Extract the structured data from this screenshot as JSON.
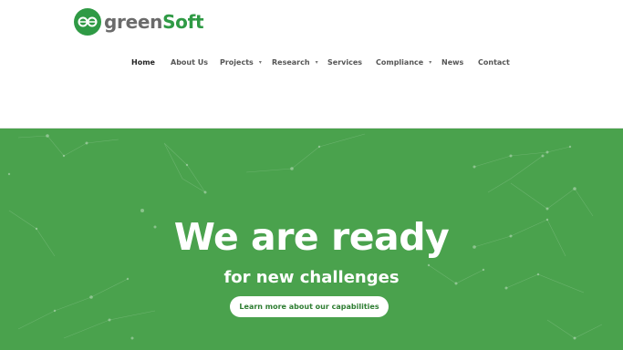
{
  "brand": {
    "name_part1": "green",
    "name_part2": "Soft",
    "mark_icon": "infinity-loops-icon"
  },
  "nav": {
    "items": [
      {
        "label": "Home",
        "active": true,
        "dropdown": false
      },
      {
        "label": "About Us",
        "active": false,
        "dropdown": false
      },
      {
        "label": "Projects",
        "active": false,
        "dropdown": true
      },
      {
        "label": "Research",
        "active": false,
        "dropdown": true
      },
      {
        "label": "Services",
        "active": false,
        "dropdown": false
      },
      {
        "label": "Compliance",
        "active": false,
        "dropdown": true
      },
      {
        "label": "News",
        "active": false,
        "dropdown": false
      },
      {
        "label": "Contact",
        "active": false,
        "dropdown": false
      }
    ],
    "caret_glyph": "▾"
  },
  "hero": {
    "title": "We are ready",
    "subtitle": "for new challenges",
    "cta_label": "Learn more about our capabilities",
    "background_color": "#4aa24d"
  },
  "colors": {
    "brand_green": "#2f9a45",
    "text_dark": "#222222",
    "text_gray": "#555555"
  }
}
